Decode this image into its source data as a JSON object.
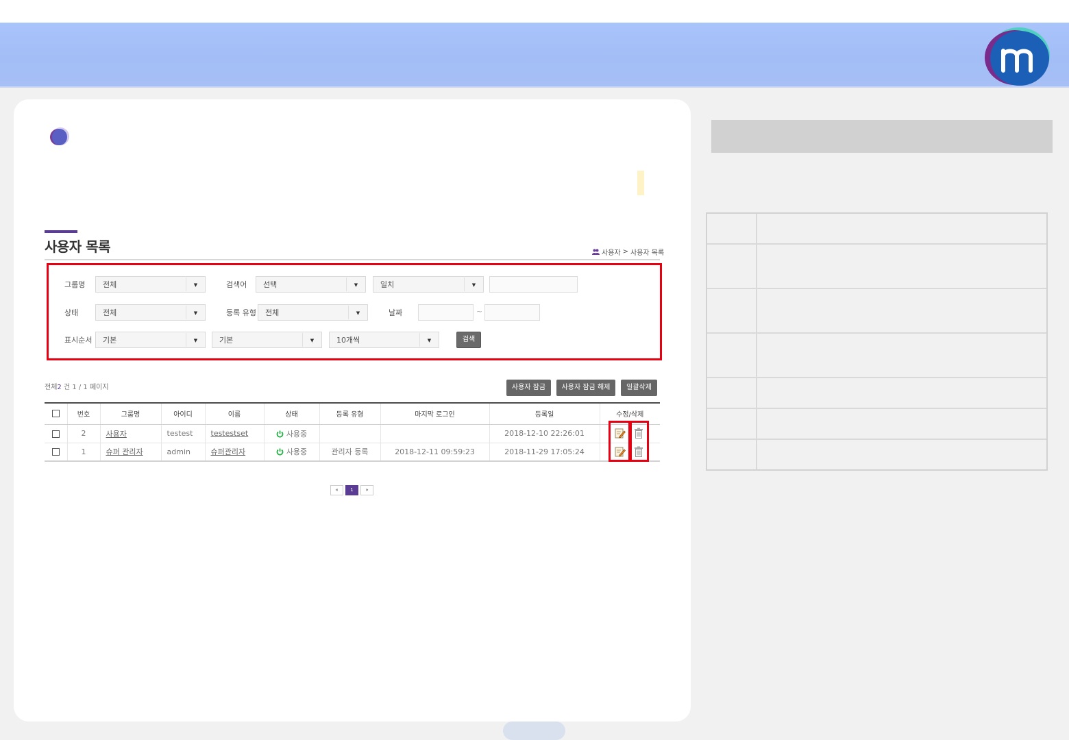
{
  "page": {
    "title": "사용자 목록",
    "breadcrumb": [
      "사용자",
      "사용자 목록"
    ],
    "breadcrumb_sep": ">"
  },
  "search": {
    "group_label": "그룹명",
    "group_value": "전체",
    "keyword_label": "검색어",
    "keyword_field_value": "선택",
    "keyword_match_value": "일치",
    "status_label": "상태",
    "status_value": "전체",
    "regtype_label": "등록 유형",
    "regtype_value": "전체",
    "date_label": "날짜",
    "date_sep": "~",
    "order_label": "표시순서",
    "order_value1": "기본",
    "order_value2": "기본",
    "page_size_value": "10개씩",
    "search_button": "검색"
  },
  "summary": {
    "prefix": "전체",
    "total": "2",
    "suffix": "건 1 / 1 페이지"
  },
  "actions": {
    "lock": "사용자 잠금",
    "unlock": "사용자 잠금 해제",
    "bulk_delete": "일괄삭제"
  },
  "table": {
    "headers": [
      "번호",
      "그룹명",
      "아이디",
      "이름",
      "상태",
      "등록 유형",
      "마지막 로그인",
      "등록일",
      "수정/삭제"
    ],
    "rows": [
      {
        "no": "2",
        "group": "사용자",
        "id": "testest",
        "name": "testestset",
        "status": "사용중",
        "reg_type": "",
        "last_login": "",
        "reg_date": "2018-12-10 22:26:01"
      },
      {
        "no": "1",
        "group": "슈퍼 관리자",
        "id": "admin",
        "name": "슈퍼관리자",
        "status": "사용중",
        "reg_type": "관리자 등록",
        "last_login": "2018-12-11 09:59:23",
        "reg_date": "2018-11-29 17:05:24"
      }
    ]
  },
  "pagination": {
    "first": "«",
    "current": "1",
    "last": "»"
  },
  "colors": {
    "accent": "#5b3c94",
    "highlight_box": "#e60012",
    "status_green": "#2bb14a",
    "header_blue": "#a6bff6"
  },
  "icons": {
    "edit": "edit-icon",
    "delete": "trash-icon",
    "status": "power-icon",
    "logo": "m-logo"
  }
}
